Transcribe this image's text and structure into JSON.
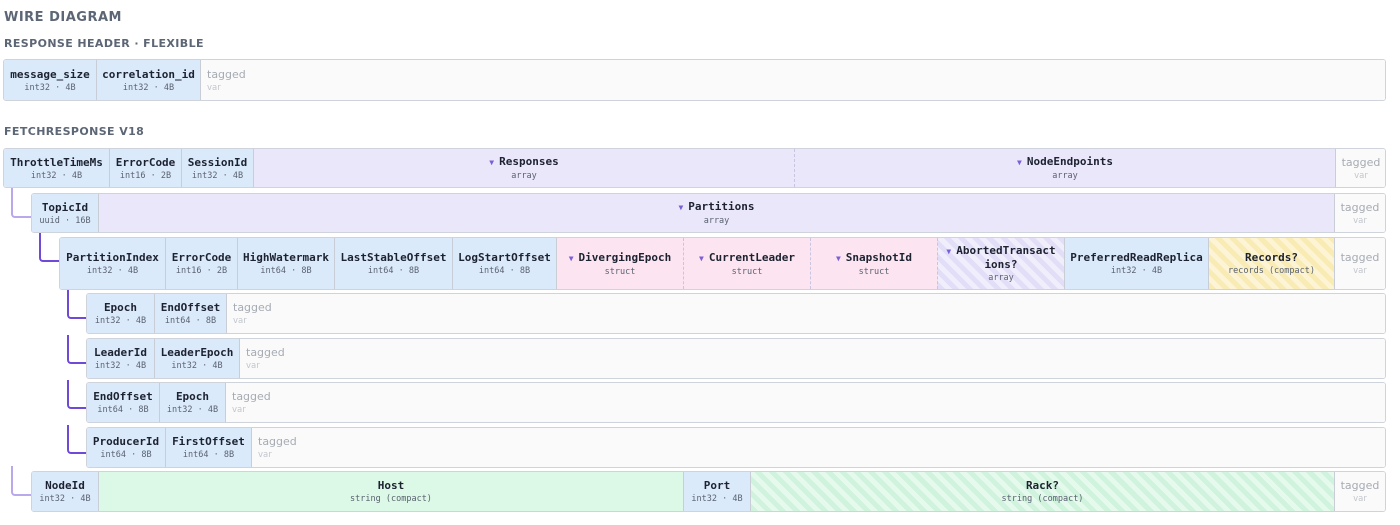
{
  "heading": "WIRE DIAGRAM",
  "response_header": {
    "title": "RESPONSE HEADER · FLEXIBLE",
    "fields": [
      {
        "name": "message_size",
        "type": "int32 · 4B"
      },
      {
        "name": "correlation_id",
        "type": "int32 · 4B"
      }
    ],
    "tagged": {
      "label": "tagged",
      "type": "var"
    }
  },
  "fetch_response": {
    "title": "FETCHRESPONSE V18",
    "top": {
      "fields": [
        {
          "name": "ThrottleTimeMs",
          "type": "int32 · 4B"
        },
        {
          "name": "ErrorCode",
          "type": "int16 · 2B"
        },
        {
          "name": "SessionId",
          "type": "int32 · 4B"
        },
        {
          "name": "Responses",
          "type": "array"
        },
        {
          "name": "NodeEndpoints",
          "type": "array"
        }
      ],
      "tagged": {
        "label": "tagged",
        "type": "var"
      }
    },
    "responses": {
      "fields": [
        {
          "name": "TopicId",
          "type": "uuid · 16B"
        },
        {
          "name": "Partitions",
          "type": "array"
        }
      ],
      "tagged": {
        "label": "tagged",
        "type": "var"
      }
    },
    "partitions": {
      "fields": [
        {
          "name": "PartitionIndex",
          "type": "int32 · 4B"
        },
        {
          "name": "ErrorCode",
          "type": "int16 · 2B"
        },
        {
          "name": "HighWatermark",
          "type": "int64 · 8B"
        },
        {
          "name": "LastStableOffset",
          "type": "int64 · 8B"
        },
        {
          "name": "LogStartOffset",
          "type": "int64 · 8B"
        },
        {
          "name": "DivergingEpoch",
          "type": "struct"
        },
        {
          "name": "CurrentLeader",
          "type": "struct"
        },
        {
          "name": "SnapshotId",
          "type": "struct"
        },
        {
          "name": "AbortedTransactions?",
          "type": "array"
        },
        {
          "name": "PreferredReadReplica",
          "type": "int32 · 4B"
        },
        {
          "name": "Records?",
          "type": "records (compact)"
        }
      ],
      "tagged": {
        "label": "tagged",
        "type": "var"
      }
    },
    "diverging_epoch": {
      "fields": [
        {
          "name": "Epoch",
          "type": "int32 · 4B"
        },
        {
          "name": "EndOffset",
          "type": "int64 · 8B"
        }
      ],
      "tagged": {
        "label": "tagged",
        "type": "var"
      }
    },
    "current_leader": {
      "fields": [
        {
          "name": "LeaderId",
          "type": "int32 · 4B"
        },
        {
          "name": "LeaderEpoch",
          "type": "int32 · 4B"
        }
      ],
      "tagged": {
        "label": "tagged",
        "type": "var"
      }
    },
    "snapshot_id": {
      "fields": [
        {
          "name": "EndOffset",
          "type": "int64 · 8B"
        },
        {
          "name": "Epoch",
          "type": "int32 · 4B"
        }
      ],
      "tagged": {
        "label": "tagged",
        "type": "var"
      }
    },
    "aborted_transactions": {
      "fields": [
        {
          "name": "ProducerId",
          "type": "int64 · 8B"
        },
        {
          "name": "FirstOffset",
          "type": "int64 · 8B"
        }
      ],
      "tagged": {
        "label": "tagged",
        "type": "var"
      }
    },
    "node_endpoints": {
      "fields": [
        {
          "name": "NodeId",
          "type": "int32 · 4B"
        },
        {
          "name": "Host",
          "type": "string (compact)"
        },
        {
          "name": "Port",
          "type": "int32 · 4B"
        },
        {
          "name": "Rack?",
          "type": "string (compact)"
        }
      ],
      "tagged": {
        "label": "tagged",
        "type": "var"
      }
    }
  },
  "colors": {
    "fixed": "#dbeafb",
    "array": "#ebe7fb",
    "struct": "#fce4f1",
    "string": "#dcf8e6",
    "records": "#fbf0c2",
    "connector": "#6f4ad6"
  },
  "icons": {
    "expand": "triangle-down-icon"
  }
}
